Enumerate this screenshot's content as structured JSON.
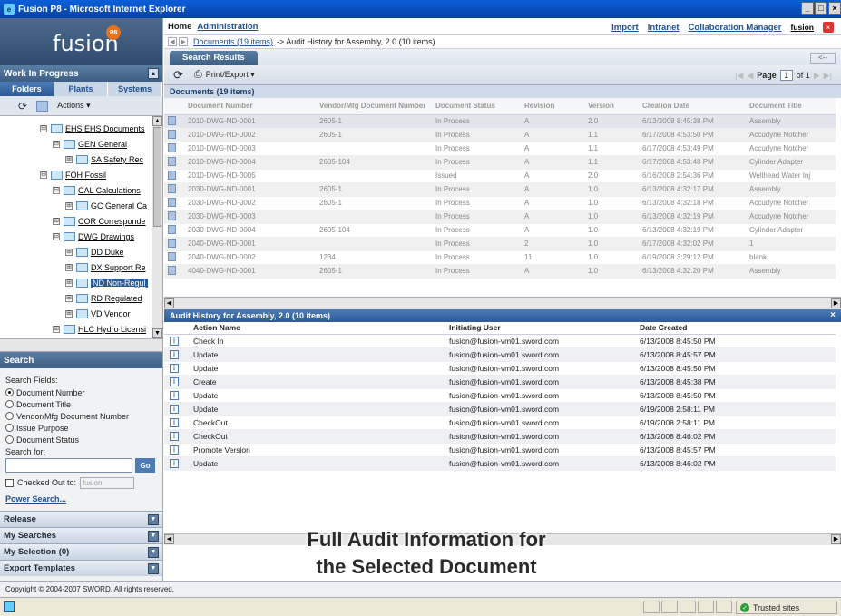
{
  "window": {
    "title": "Fusion P8 - Microsoft Internet Explorer"
  },
  "logo": {
    "word": "fusion",
    "badge": "P8"
  },
  "left": {
    "wip_title": "Work In Progress",
    "tabs": [
      "Folders",
      "Plants",
      "Systems"
    ],
    "actions_label": "Actions ▾",
    "tree": [
      {
        "label": "EHS EHS Documents",
        "indent": 0,
        "pm": "⊟"
      },
      {
        "label": "GEN General",
        "indent": 1,
        "pm": "⊟"
      },
      {
        "label": "SA Safety Rec",
        "indent": 2,
        "pm": "⊞"
      },
      {
        "label": "FOH Fossil",
        "indent": 0,
        "pm": "⊟"
      },
      {
        "label": "CAL Calculations",
        "indent": 1,
        "pm": "⊟"
      },
      {
        "label": "GC General Ca",
        "indent": 2,
        "pm": "⊞"
      },
      {
        "label": "COR Corresponde",
        "indent": 1,
        "pm": "⊞"
      },
      {
        "label": "DWG Drawings",
        "indent": 1,
        "pm": "⊟"
      },
      {
        "label": "DD Duke",
        "indent": 2,
        "pm": "⊞"
      },
      {
        "label": "DX Support Re",
        "indent": 2,
        "pm": "⊞"
      },
      {
        "label": "ND Non-Regul",
        "indent": 2,
        "pm": "⊞",
        "selected": true
      },
      {
        "label": "RD Regulated",
        "indent": 2,
        "pm": "⊞"
      },
      {
        "label": "VD Vendor",
        "indent": 2,
        "pm": "⊞"
      },
      {
        "label": "HLC Hydro Licensi",
        "indent": 1,
        "pm": "⊞"
      }
    ],
    "search": {
      "title": "Search",
      "fields_label": "Search Fields:",
      "options": [
        "Document Number",
        "Document Title",
        "Vendor/Mfg Document Number",
        "Issue Purpose",
        "Document Status"
      ],
      "selected_index": 0,
      "search_for_label": "Search for:",
      "go_label": "Go",
      "checked_out_label": "Checked Out to:",
      "checked_out_user": "fusion",
      "power_search": "Power Search..."
    },
    "accordions": [
      "Release",
      "My Searches",
      "My Selection (0)",
      "Export Templates"
    ]
  },
  "topnav": {
    "home": "Home",
    "admin": "Administration",
    "links": [
      "Import",
      "Intranet",
      "Collaboration Manager",
      "fusion"
    ]
  },
  "crumb": {
    "link": "Documents (19 items)",
    "rest": "-> Audit History for Assembly, 2.0 (10 items)",
    "back": "<--"
  },
  "tab": "Search Results",
  "toolbar": {
    "print": "Print/Export ▾",
    "page_label": "Page",
    "page_value": "1",
    "of": "of 1"
  },
  "docs": {
    "bar": "Documents (19 items)",
    "columns": [
      "Document Number",
      "Vendor/Mfg Document Number",
      "Document Status",
      "Revision",
      "Version",
      "Creation Date",
      "Document Title"
    ],
    "rows": [
      [
        "2010-DWG-ND-0001",
        "2605-1",
        "In Process",
        "A",
        "2.0",
        "6/13/2008 8:45:38 PM",
        "Assembly"
      ],
      [
        "2010-DWG-ND-0002",
        "2605-1",
        "In Process",
        "A",
        "1.1",
        "6/17/2008 4:53:50 PM",
        "Accudyne Notcher"
      ],
      [
        "2010-DWG-ND-0003",
        "",
        "In Process",
        "A",
        "1.1",
        "6/17/2008 4:53:49 PM",
        "Accudyne Notcher"
      ],
      [
        "2010-DWG-ND-0004",
        "2605-104",
        "In Process",
        "A",
        "1.1",
        "6/17/2008 4:53:48 PM",
        "Cylinder Adapter"
      ],
      [
        "2010-DWG-ND-0005",
        "",
        "Issued",
        "A",
        "2.0",
        "6/16/2008 2:54:36 PM",
        "Wellhead Water Inj"
      ],
      [
        "2030-DWG-ND-0001",
        "2605-1",
        "In Process",
        "A",
        "1.0",
        "6/13/2008 4:32:17 PM",
        "Assembly"
      ],
      [
        "2030-DWG-ND-0002",
        "2605-1",
        "In Process",
        "A",
        "1.0",
        "6/13/2008 4:32:18 PM",
        "Accudyne Notcher"
      ],
      [
        "2030-DWG-ND-0003",
        "",
        "In Process",
        "A",
        "1.0",
        "6/13/2008 4:32:19 PM",
        "Accudyne Notcher"
      ],
      [
        "2030-DWG-ND-0004",
        "2605-104",
        "In Process",
        "A",
        "1.0",
        "6/13/2008 4:32:19 PM",
        "Cylinder Adapter"
      ],
      [
        "2040-DWG-ND-0001",
        "",
        "In Process",
        "2",
        "1.0",
        "6/17/2008 4:32:02 PM",
        "1"
      ],
      [
        "2040-DWG-ND-0002",
        "1234",
        "In Process",
        "11",
        "1.0",
        "6/19/2008 3:29:12 PM",
        "blank"
      ],
      [
        "4040-DWG-ND-0001",
        "2605-1",
        "In Process",
        "A",
        "1.0",
        "6/13/2008 4:32:20 PM",
        "Assembly"
      ]
    ]
  },
  "audit": {
    "bar": "Audit History for Assembly, 2.0 (10 items)",
    "columns": [
      "Action Name",
      "Initiating User",
      "Date Created"
    ],
    "rows": [
      [
        "Check In",
        "fusion@fusion-vm01.sword.com",
        "6/13/2008 8:45:50 PM"
      ],
      [
        "Update",
        "fusion@fusion-vm01.sword.com",
        "6/13/2008 8:45:57 PM"
      ],
      [
        "Update",
        "fusion@fusion-vm01.sword.com",
        "6/13/2008 8:45:50 PM"
      ],
      [
        "Create",
        "fusion@fusion-vm01.sword.com",
        "6/13/2008 8:45:38 PM"
      ],
      [
        "Update",
        "fusion@fusion-vm01.sword.com",
        "6/13/2008 8:45:50 PM"
      ],
      [
        "Update",
        "fusion@fusion-vm01.sword.com",
        "6/19/2008 2:58:11 PM"
      ],
      [
        "CheckOut",
        "fusion@fusion-vm01.sword.com",
        "6/19/2008 2:58:11 PM"
      ],
      [
        "CheckOut",
        "fusion@fusion-vm01.sword.com",
        "6/13/2008 8:46:02 PM"
      ],
      [
        "Promote Version",
        "fusion@fusion-vm01.sword.com",
        "6/13/2008 8:45:57 PM"
      ],
      [
        "Update",
        "fusion@fusion-vm01.sword.com",
        "6/13/2008 8:46:02 PM"
      ]
    ]
  },
  "caption": {
    "line1": "Full Audit Information for",
    "line2": "the Selected Document"
  },
  "footer": {
    "copyright": "Copyright © 2004-2007 SWORD. All rights reserved."
  },
  "status": {
    "zone": "Trusted sites"
  }
}
